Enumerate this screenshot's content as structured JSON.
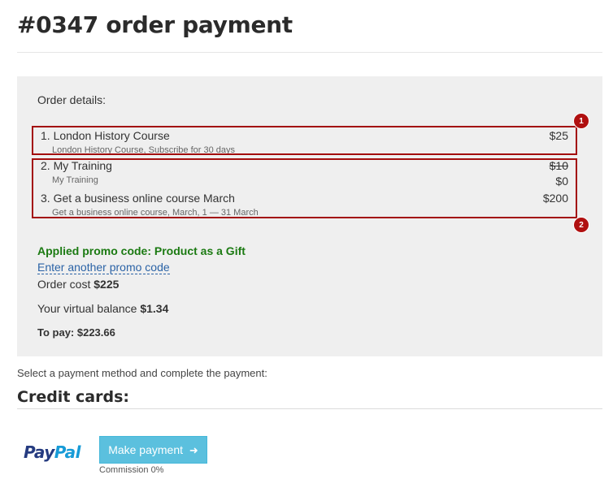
{
  "page": {
    "title": "#0347 order payment"
  },
  "order": {
    "label": "Order details:",
    "items": [
      {
        "title": "1. London History Course",
        "subtitle": "London History Course, Subscribe for 30 days",
        "price": "$25"
      },
      {
        "title": "2. My Training",
        "subtitle": "My Training",
        "old_price": "$10",
        "price": "$0"
      },
      {
        "title": "3. Get a business online course March",
        "subtitle": "Get a business online course, March, 1 — 31 March",
        "price": "$200"
      }
    ],
    "badges": [
      "1",
      "2"
    ],
    "promo_applied": "Applied promo code: Product as a Gift",
    "promo_link": "Enter another promo code",
    "cost_label": "Order cost",
    "cost_value": "$225",
    "balance_label": "Your virtual balance",
    "balance_value": "$1.34",
    "topay": "To pay: $223.66"
  },
  "payment": {
    "instructions": "Select a payment method and complete the payment:",
    "heading": "Credit cards:",
    "provider_part1": "Pay",
    "provider_part2": "Pal",
    "button_label": "Make payment",
    "commission": "Commission 0%"
  },
  "colors": {
    "panel_bg": "#efefef",
    "promo_green": "#1b7a12",
    "link_blue": "#2b63a6",
    "annotation_red": "#a30e0e",
    "button_bg": "#5bc0de",
    "paypal_dark": "#253b80",
    "paypal_light": "#179bd7"
  }
}
